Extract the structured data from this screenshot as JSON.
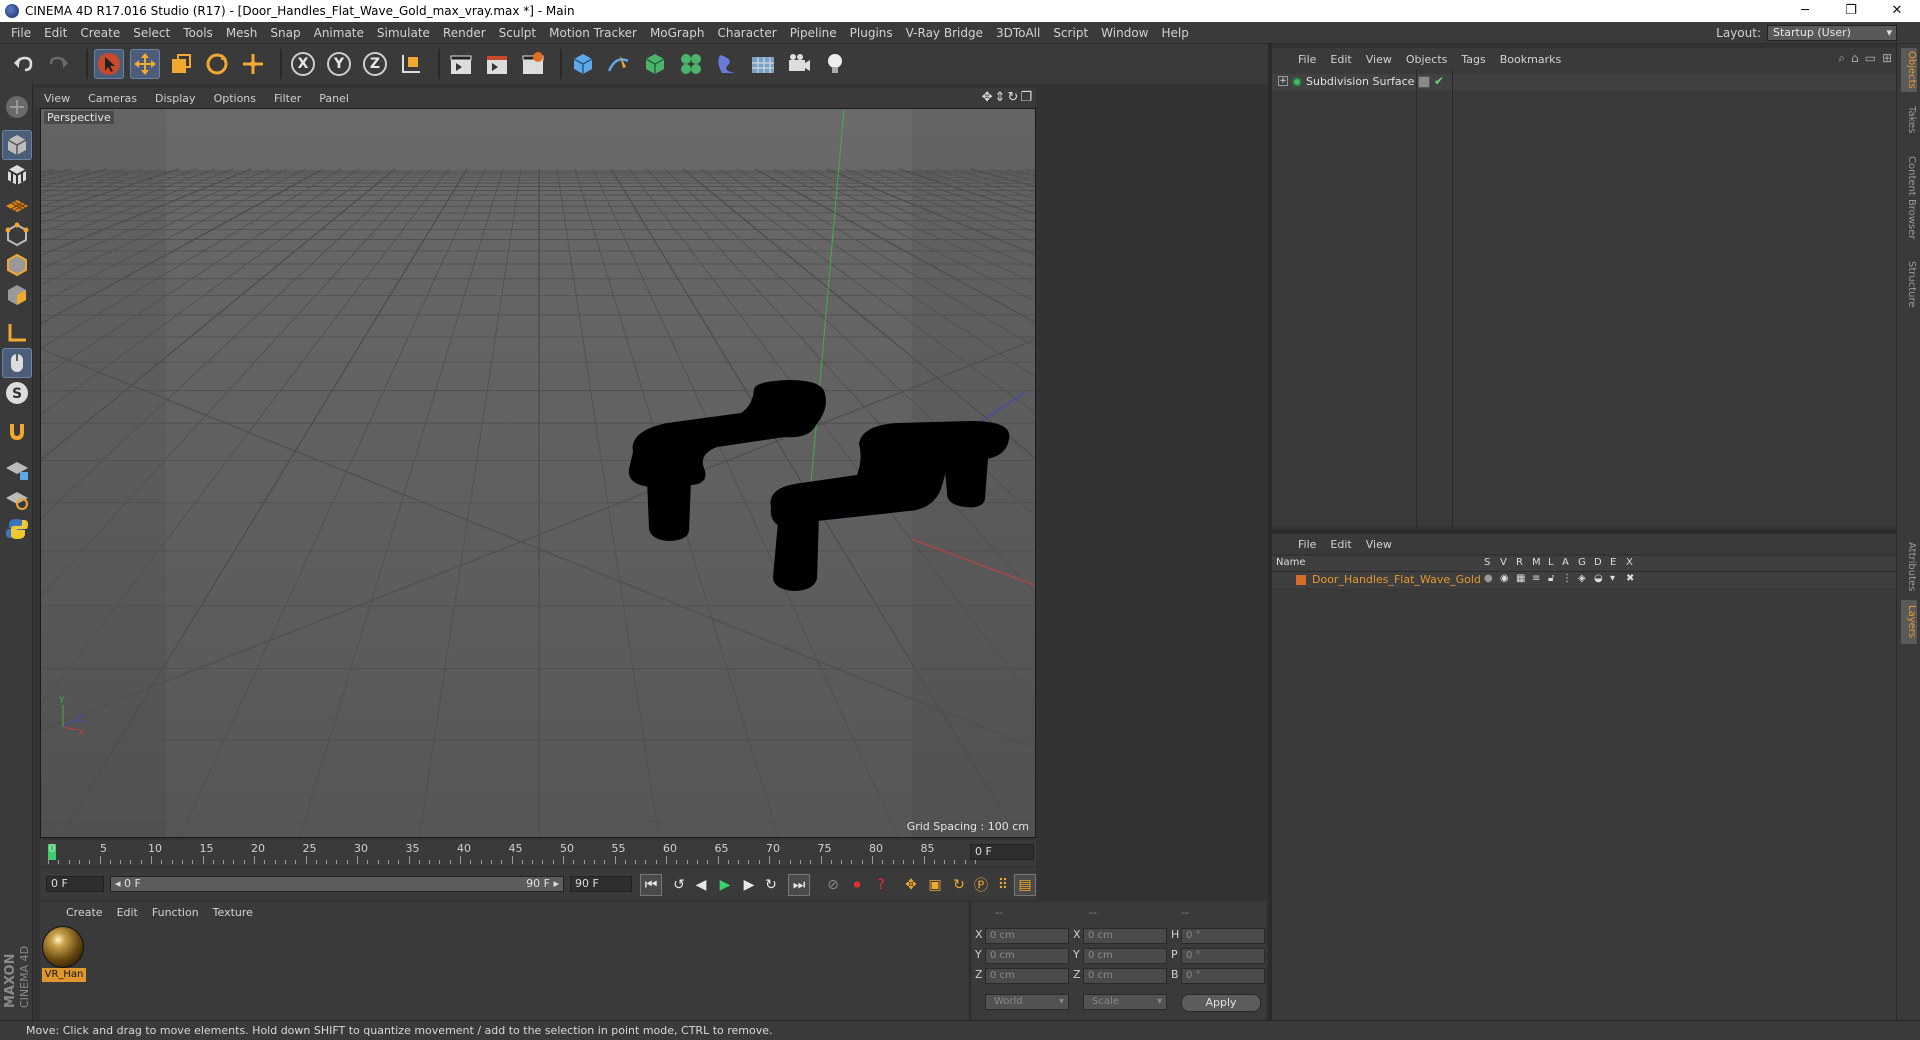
{
  "window": {
    "title": "CINEMA 4D R17.016 Studio (R17) - [Door_Handles_Flat_Wave_Gold_max_vray.max *] - Main",
    "controls": [
      "─",
      "❐",
      "✕"
    ]
  },
  "menu": [
    "File",
    "Edit",
    "Create",
    "Select",
    "Tools",
    "Mesh",
    "Snap",
    "Animate",
    "Simulate",
    "Render",
    "Sculpt",
    "Motion Tracker",
    "MoGraph",
    "Character",
    "Pipeline",
    "Plugins",
    "V-Ray Bridge",
    "3DToAll",
    "Script",
    "Window",
    "Help"
  ],
  "layout": {
    "label": "Layout:",
    "value": "Startup (User)"
  },
  "toolbar": {
    "axis_x": "X",
    "axis_y": "Y",
    "axis_z": "Z"
  },
  "viewport": {
    "menu": [
      "View",
      "Cameras",
      "Display",
      "Options",
      "Filter",
      "Panel"
    ],
    "label": "Perspective",
    "grid_spacing": "Grid Spacing : 100 cm",
    "axis_gizmo": {
      "y": "Y",
      "x": "X",
      "z": "Z"
    }
  },
  "timeline": {
    "ticks": [
      0,
      5,
      10,
      15,
      20,
      25,
      30,
      35,
      40,
      45,
      50,
      55,
      60,
      65,
      70,
      75,
      80,
      85,
      90
    ],
    "current_frame": 0,
    "end_frame_label": "0 F"
  },
  "transport": {
    "start_field": "0 F",
    "slider_left": "◂ 0 F",
    "slider_right": "90 F ▸",
    "end_field": "90 F"
  },
  "material_manager": {
    "menu": [
      "Create",
      "Edit",
      "Function",
      "Texture"
    ],
    "materials": [
      {
        "name": "VR_Han"
      }
    ]
  },
  "coordinates": {
    "headers": [
      "--",
      "--",
      "--"
    ],
    "rows": [
      {
        "a1": "X",
        "v1": "0 cm",
        "a2": "X",
        "v2": "0 cm",
        "a3": "H",
        "v3": "0 °"
      },
      {
        "a1": "Y",
        "v1": "0 cm",
        "a2": "Y",
        "v2": "0 cm",
        "a3": "P",
        "v3": "0 °"
      },
      {
        "a1": "Z",
        "v1": "0 cm",
        "a2": "Z",
        "v2": "0 cm",
        "a3": "B",
        "v3": "0 °"
      }
    ],
    "space": "World",
    "mode": "Scale",
    "apply": "Apply"
  },
  "objects_panel": {
    "menu": [
      "File",
      "Edit",
      "View",
      "Objects",
      "Tags",
      "Bookmarks"
    ],
    "items": [
      {
        "name": "Subdivision Surface"
      }
    ]
  },
  "layers_panel": {
    "menu": [
      "File",
      "Edit",
      "View"
    ],
    "columns": [
      "Name",
      "S",
      "V",
      "R",
      "M",
      "L",
      "A",
      "G",
      "D",
      "E",
      "X"
    ],
    "items": [
      {
        "name": "Door_Handles_Flat_Wave_Gold",
        "color": "#d86a2a"
      }
    ]
  },
  "side_tabs": [
    "Objects",
    "Takes",
    "Content Browser",
    "Structure",
    "Attributes",
    "Layers"
  ],
  "status": "Move: Click and drag to move elements. Hold down SHIFT to quantize movement / add to the selection in point mode, CTRL to remove.",
  "branding": {
    "maxon": "MAXON",
    "cinema": "CINEMA 4D"
  },
  "colors": {
    "accent": "#e8982c",
    "active_tool": "#4b5d78",
    "timeline_cursor": "#37d26a"
  }
}
